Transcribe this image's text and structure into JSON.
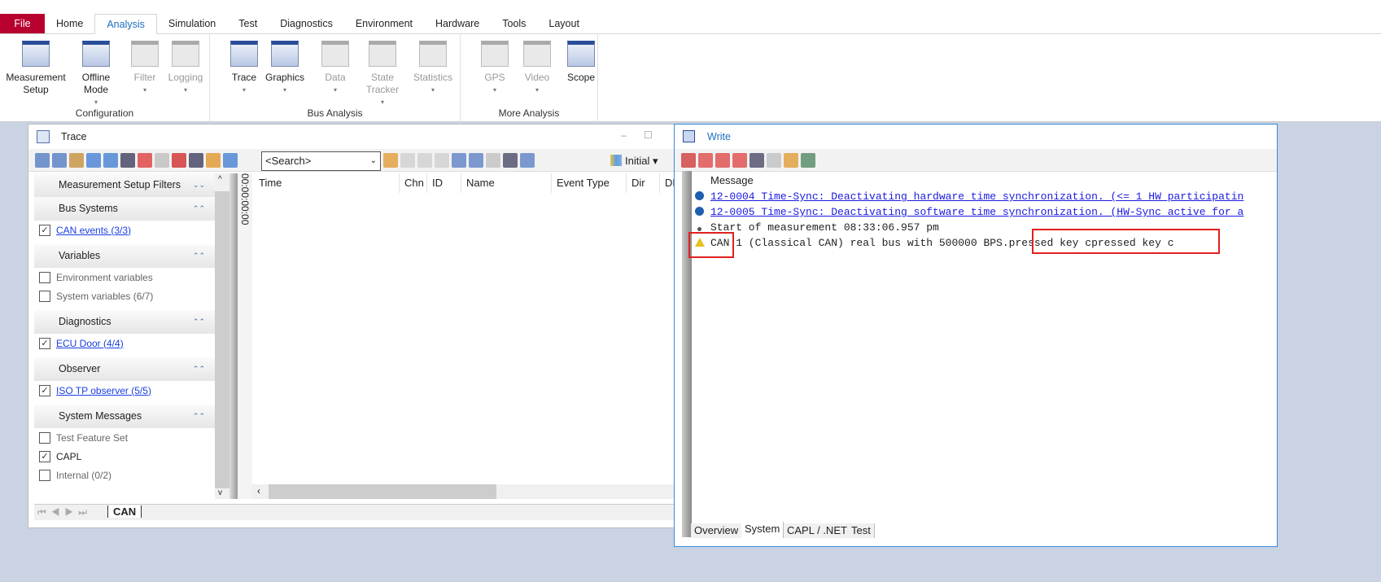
{
  "ribbon": {
    "tabs": [
      "File",
      "Home",
      "Analysis",
      "Simulation",
      "Test",
      "Diagnostics",
      "Environment",
      "Hardware",
      "Tools",
      "Layout"
    ],
    "active_tab": "Analysis",
    "groups": [
      {
        "label": "Configuration",
        "buttons": [
          {
            "label": "Measurement Setup",
            "enabled": true
          },
          {
            "label": "Offline Mode",
            "enabled": true
          },
          {
            "label": "Filter",
            "enabled": false
          },
          {
            "label": "Logging",
            "enabled": false
          }
        ]
      },
      {
        "label": "Bus Analysis",
        "buttons": [
          {
            "label": "Trace",
            "enabled": true
          },
          {
            "label": "Graphics",
            "enabled": true
          },
          {
            "label": "Data",
            "enabled": false
          },
          {
            "label": "State Tracker",
            "enabled": false
          },
          {
            "label": "Statistics",
            "enabled": false
          }
        ]
      },
      {
        "label": "More Analysis",
        "buttons": [
          {
            "label": "GPS",
            "enabled": false
          },
          {
            "label": "Video",
            "enabled": false
          },
          {
            "label": "Scope",
            "enabled": true
          }
        ]
      }
    ]
  },
  "trace": {
    "title": "Trace",
    "search_placeholder": "<Search>",
    "layout_select": "Initial",
    "sidebar": {
      "header": "Measurement Setup Filters",
      "sections": [
        {
          "title": "Bus Systems",
          "items": [
            {
              "label": "CAN events (3/3)",
              "checked": true,
              "link": true
            }
          ]
        },
        {
          "title": "Variables",
          "items": [
            {
              "label": "Environment variables",
              "checked": false
            },
            {
              "label": "System variables (6/7)",
              "checked": false
            }
          ]
        },
        {
          "title": "Diagnostics",
          "items": [
            {
              "label": "ECU Door (4/4)",
              "checked": true,
              "link": true
            }
          ]
        },
        {
          "title": "Observer",
          "items": [
            {
              "label": "ISO TP observer (5/5)",
              "checked": true,
              "link": true
            }
          ]
        },
        {
          "title": "System Messages",
          "items": [
            {
              "label": "Test Feature Set",
              "checked": false
            },
            {
              "label": "CAPL",
              "checked": true
            },
            {
              "label": "Internal (0/2)",
              "checked": false
            }
          ]
        }
      ]
    },
    "time_marker": "00:00:00:00",
    "columns": [
      "Time",
      "Chn",
      "ID",
      "Name",
      "Event Type",
      "Dir",
      "DL"
    ],
    "page_tab": "CAN"
  },
  "write": {
    "title": "Write",
    "column": "Message",
    "messages": [
      {
        "icon": "info-icon",
        "text": "12-0004 Time-Sync: Deactivating hardware time synchronization. (<= 1 HW participatin",
        "link": true
      },
      {
        "icon": "info-icon",
        "text": "12-0005 Time-Sync: Deactivating software time synchronization. (HW-Sync active for a",
        "link": true
      },
      {
        "icon": "bullet-icon",
        "text": "Start of measurement 08:33:06.957 pm",
        "link": false
      },
      {
        "icon": "warning-icon",
        "text": "CAN 1 (Classical CAN)  real bus with 500000 BPS.pressed key cpressed key c",
        "link": false
      }
    ],
    "tabs": [
      "Overview",
      "System",
      "CAPL / .NET",
      "Test"
    ],
    "active_tab": "System"
  },
  "colors": {
    "file_tab": "#b8002f",
    "accent": "#1c6fc2",
    "highlight_box": "#e02020",
    "link": "#1a1ae0"
  }
}
